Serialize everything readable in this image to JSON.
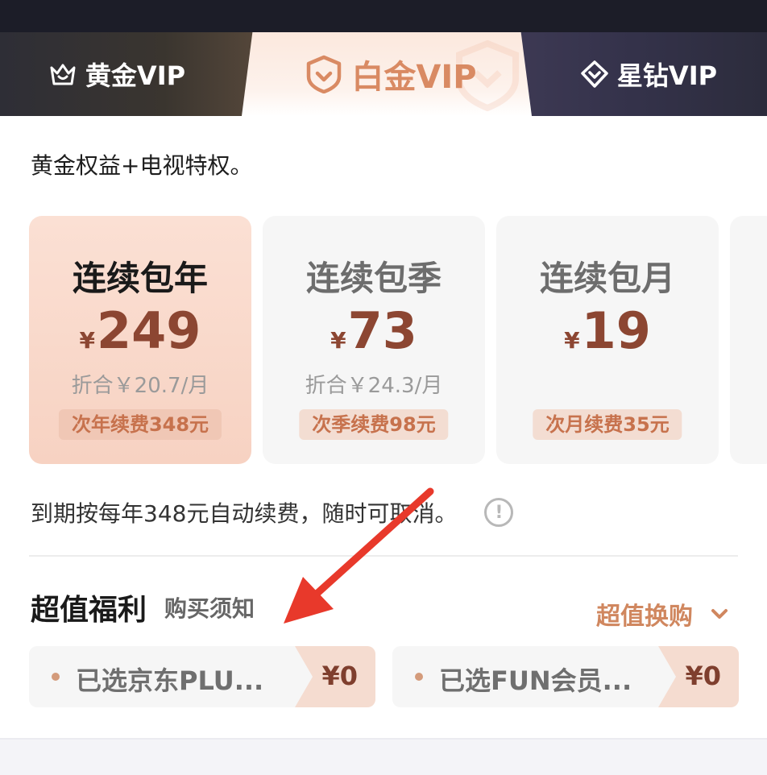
{
  "tabs": [
    {
      "label": "黄金VIP",
      "icon": "crown-icon"
    },
    {
      "label": "白金VIP",
      "icon": "shield-heart-icon",
      "active": true
    },
    {
      "label": "星钻VIP",
      "icon": "diamond-heart-icon"
    }
  ],
  "description": "黄金权益+电视特权。",
  "plans": [
    {
      "name": "连续包年",
      "currency": "¥",
      "price": "249",
      "avg": "折合￥20.7/月",
      "renew": "次年续费348元",
      "selected": true
    },
    {
      "name": "连续包季",
      "currency": "¥",
      "price": "73",
      "avg": "折合￥24.3/月",
      "renew": "次季续费98元",
      "selected": false
    },
    {
      "name": "连续包月",
      "currency": "¥",
      "price": "19",
      "avg": "",
      "renew": "次月续费35元",
      "selected": false
    }
  ],
  "renew_note": "到期按每年348元自动续费，随时可取消。",
  "benefits": {
    "title": "超值福利",
    "purchase_note": "购买须知",
    "exchange_label": "超值换购",
    "items": [
      {
        "label": "已选京东PLU...",
        "price": "¥0"
      },
      {
        "label": "已选FUN会员...",
        "price": "¥0"
      }
    ]
  },
  "colors": {
    "accent": "#d98a63",
    "price": "#8c4632",
    "arrow": "#e8392b",
    "dark_bar": "#1c1d28"
  }
}
